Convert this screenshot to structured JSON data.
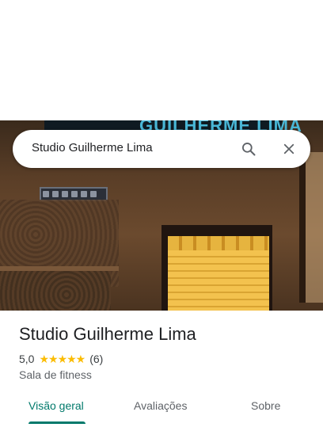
{
  "search": {
    "query": "Studio Guilherme Lima",
    "search_icon": "search-icon",
    "close_icon": "close-icon"
  },
  "photo": {
    "sign_text": "GUILHERME LIMA"
  },
  "place": {
    "title": "Studio Guilherme Lima",
    "rating": "5,0",
    "stars": "★★★★★",
    "review_count": "(6)",
    "category": "Sala de fitness"
  },
  "tabs": [
    {
      "label": "Visão geral",
      "active": true
    },
    {
      "label": "Avaliações",
      "active": false
    },
    {
      "label": "Sobre",
      "active": false
    }
  ],
  "colors": {
    "accent": "#00796b",
    "star": "#fbbc04",
    "sign": "#49b7d6"
  }
}
